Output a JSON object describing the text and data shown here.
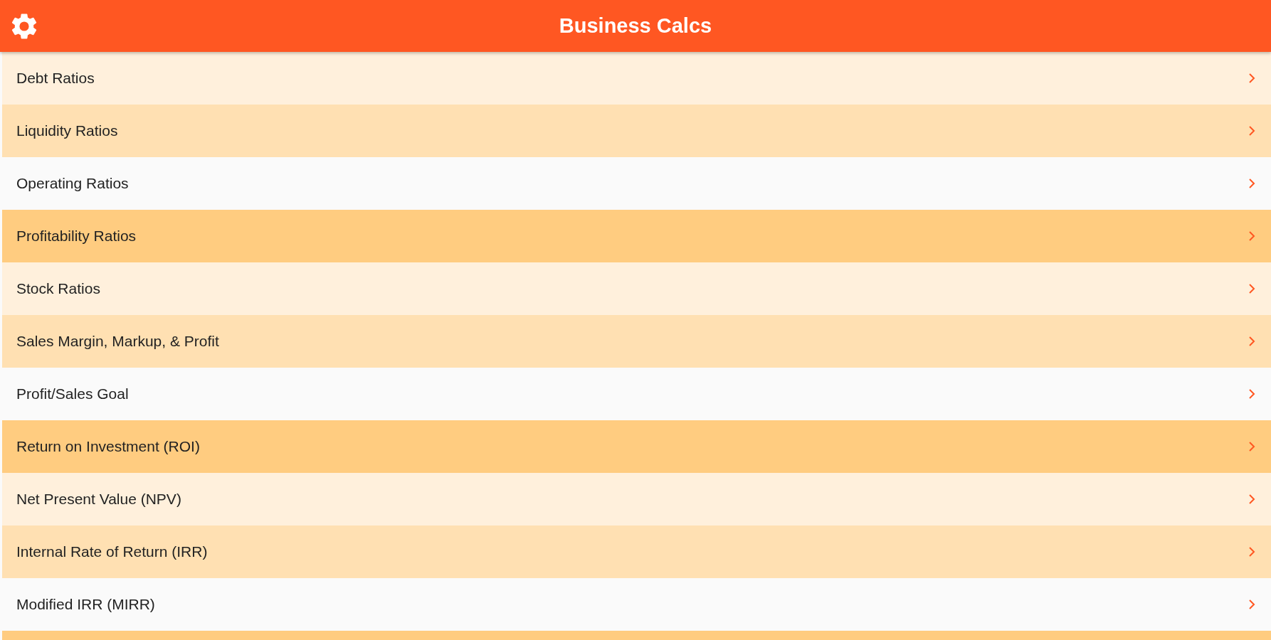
{
  "app_bar": {
    "title": "Business Calcs"
  },
  "items": [
    {
      "label": "Debt Ratios",
      "color": "#fff0dc"
    },
    {
      "label": "Liquidity Ratios",
      "color": "#ffe0b2"
    },
    {
      "label": "Operating Ratios",
      "color": "#fafafa"
    },
    {
      "label": "Profitability Ratios",
      "color": "#ffcc80"
    },
    {
      "label": "Stock Ratios",
      "color": "#fff0dc"
    },
    {
      "label": "Sales Margin, Markup, & Profit",
      "color": "#ffe0b2"
    },
    {
      "label": "Profit/Sales Goal",
      "color": "#fafafa"
    },
    {
      "label": "Return on Investment (ROI)",
      "color": "#ffcc80"
    },
    {
      "label": "Net Present Value (NPV)",
      "color": "#fff0dc"
    },
    {
      "label": "Internal Rate of Return (IRR)",
      "color": "#ffe0b2"
    },
    {
      "label": "Modified IRR (MIRR)",
      "color": "#fafafa"
    },
    {
      "color": "#ffcc80"
    }
  ]
}
